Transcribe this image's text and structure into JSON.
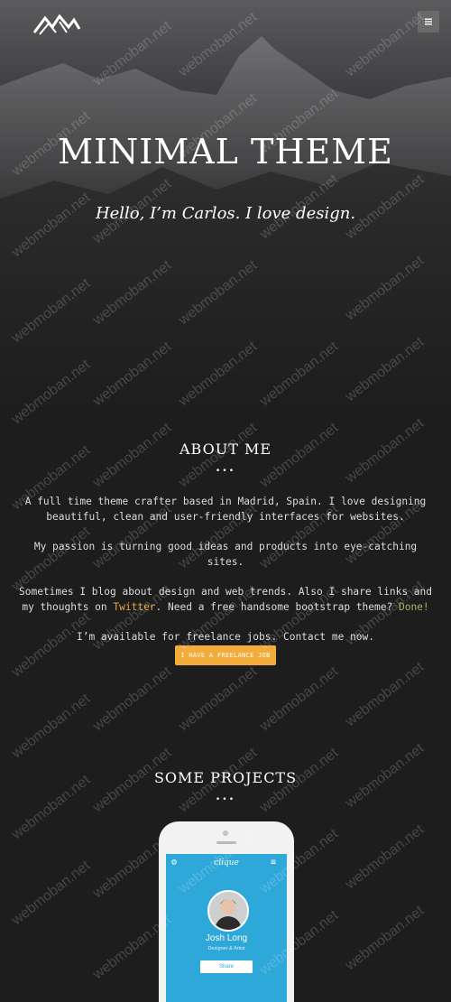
{
  "header": {
    "logo_icon": "mountain-logo-icon",
    "menu_icon": "hamburger-menu-icon"
  },
  "hero": {
    "title": "MINIMAL THEME",
    "subtitle": "Hello, I’m Carlos. I love design."
  },
  "about": {
    "title": "ABOUT ME",
    "dots": "•••",
    "p1": "A full time theme crafter based in Madrid, Spain. I love designing beautiful, clean and user-friendly interfaces for websites.",
    "p2": "My passion is turning good ideas and products into eye-catching sites.",
    "p3_before": "Sometimes I blog about design and web trends. Also I share links and my thoughts on ",
    "p3_link1": "Twitter",
    "p3_middle": ". Need a free handsome bootstrap theme? ",
    "p3_link2": "Done!",
    "p4": "I’m available for freelance jobs. Contact me now.",
    "cta_label": "I HAVE A FREELANCE JOB",
    "colors": {
      "cta": "#f3ac3a",
      "link1": "#e7a544",
      "link2": "#9fb86a"
    }
  },
  "projects": {
    "title": "SOME PROJECTS",
    "dots": "•••",
    "phone_app": {
      "logo": "clique",
      "name": "Josh Long",
      "role": "Designer & Artist",
      "button": "Share",
      "settings_icon": "gear-icon",
      "menu_icon": "hamburger-icon",
      "color": "#2ea8d9"
    }
  },
  "watermark": "webmoban.net"
}
